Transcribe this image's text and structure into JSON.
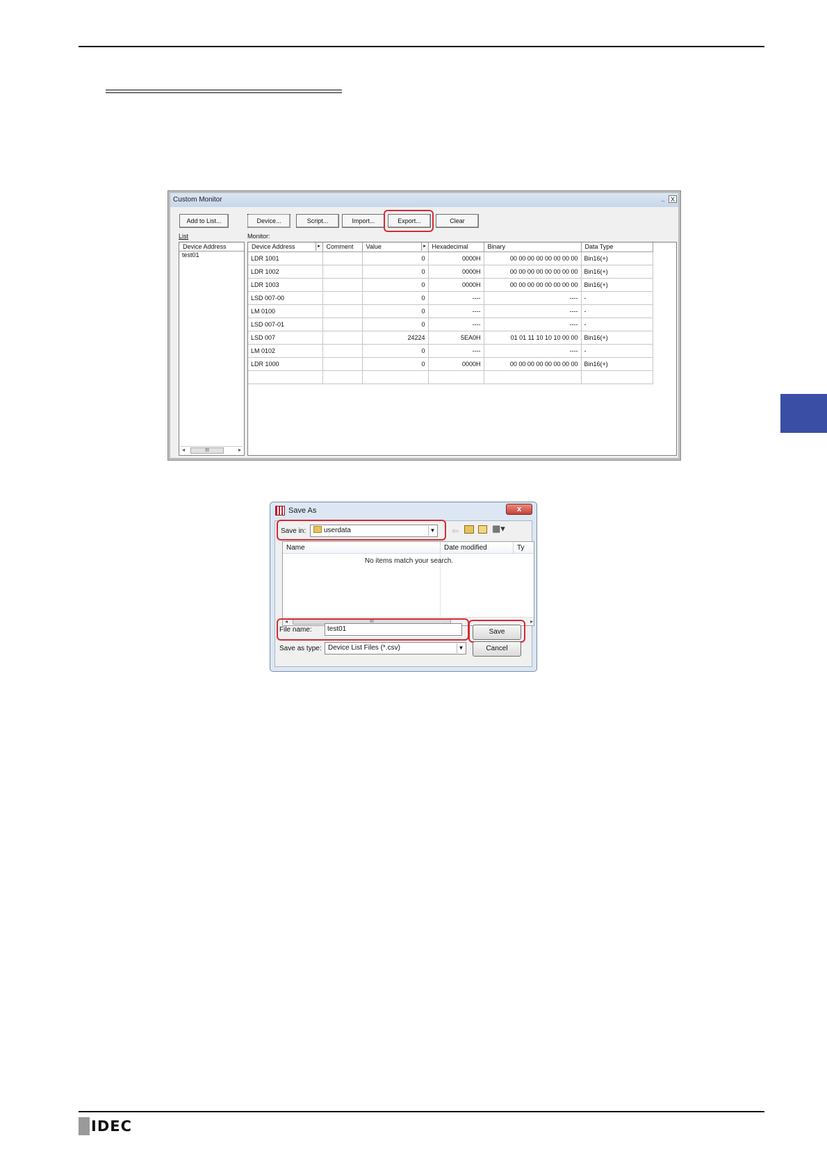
{
  "custom_monitor": {
    "title": "Custom Monitor",
    "window_controls": {
      "minimize": "_",
      "close": "X"
    },
    "buttons": {
      "add_to_list": "Add to List...",
      "device": "Device...",
      "script": "Script...",
      "import": "Import...",
      "export": "Export...",
      "clear": "Clear"
    },
    "list_label": "List",
    "monitor_label": "Monitor:",
    "list_panel": {
      "header": "Device Address",
      "items": [
        "test01"
      ],
      "scroll_left": "◂",
      "scroll_thumb": "III",
      "scroll_right": "▸"
    },
    "monitor_table": {
      "columns": [
        "Device Address",
        "Comment",
        "Value",
        "Hexadecimal",
        "Binary",
        "Data Type"
      ],
      "sort_indicator": "▸",
      "rows": [
        [
          "LDR 1001",
          "",
          "0",
          "0000H",
          "00 00 00 00 00 00 00 00",
          "Bin16(+)"
        ],
        [
          "LDR 1002",
          "",
          "0",
          "0000H",
          "00 00 00 00 00 00 00 00",
          "Bin16(+)"
        ],
        [
          "LDR 1003",
          "",
          "0",
          "0000H",
          "00 00 00 00 00 00 00 00",
          "Bin16(+)"
        ],
        [
          "LSD 007-00",
          "",
          "0",
          "----",
          "----",
          "-"
        ],
        [
          "LM 0100",
          "",
          "0",
          "----",
          "----",
          "-"
        ],
        [
          "LSD 007-01",
          "",
          "0",
          "----",
          "----",
          "-"
        ],
        [
          "LSD 007",
          "",
          "24224",
          "5EA0H",
          "01 01 11 10 10 10 00 00",
          "Bin16(+)"
        ],
        [
          "LM 0102",
          "",
          "0",
          "----",
          "----",
          "-"
        ],
        [
          "LDR 1000",
          "",
          "0",
          "0000H",
          "00 00 00 00 00 00 00 00",
          "Bin16(+)"
        ],
        [
          "",
          "",
          "",
          "",
          "",
          ""
        ]
      ]
    }
  },
  "save_as": {
    "title": "Save As",
    "close_glyph": "x",
    "save_in_label": "Save in:",
    "save_in_value": "userdata",
    "toolbar_icons": [
      "back-icon",
      "up-folder-icon",
      "new-folder-icon",
      "view-menu-icon"
    ],
    "columns": [
      "Name",
      "Date modified",
      "Ty"
    ],
    "empty_message": "No items match your search.",
    "scroll_thumb": "III",
    "file_name_label": "File name:",
    "file_name_value": "test01",
    "save_as_type_label": "Save as type:",
    "save_as_type_value": "Device List Files (*.csv)",
    "save_button": "Save",
    "cancel_button": "Cancel"
  },
  "footer": {
    "logo": "IDEC"
  },
  "colors": {
    "highlight": "#d62b35",
    "side_tab": "#3a4ea6"
  }
}
